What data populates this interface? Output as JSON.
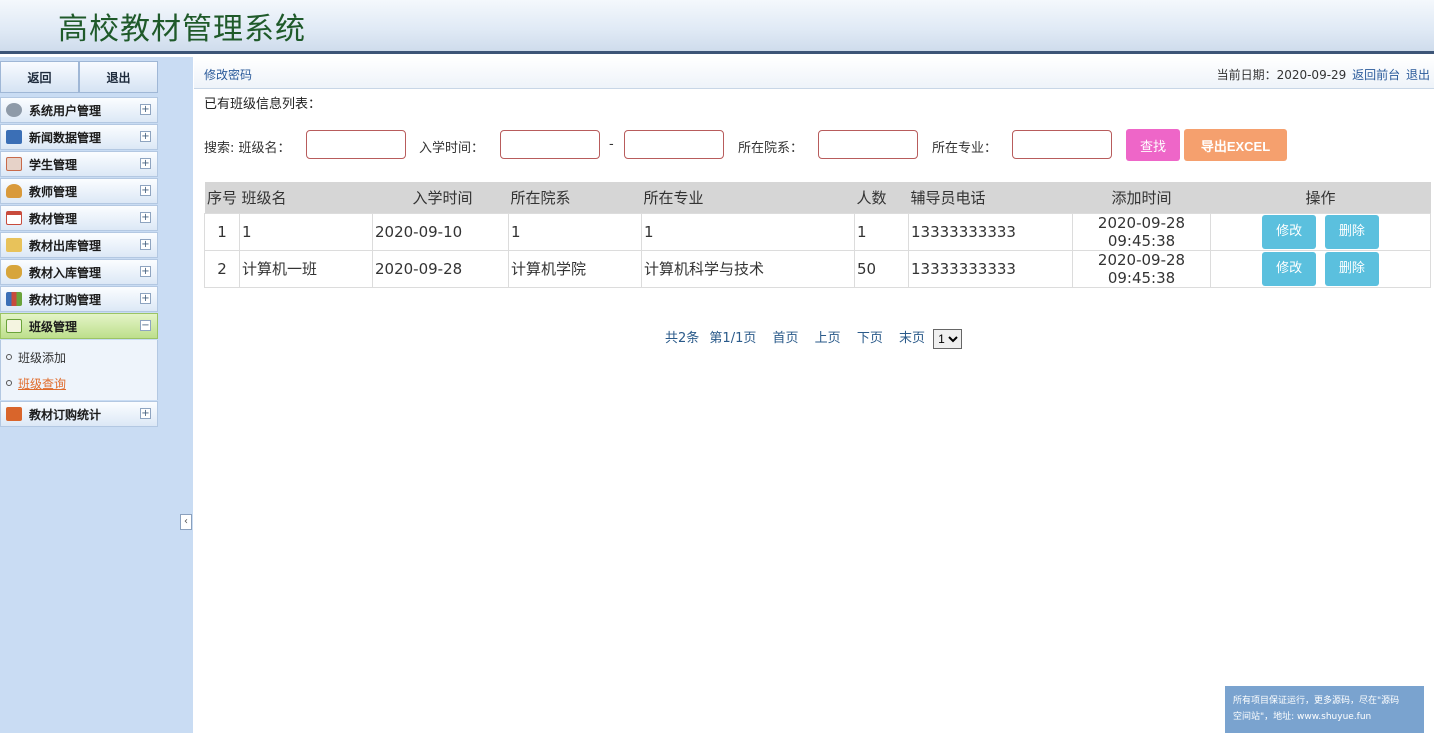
{
  "app": {
    "title": "高校教材管理系统"
  },
  "sidebar": {
    "top_buttons": [
      "返回",
      "退出"
    ],
    "menus": [
      {
        "label": "系统用户管理",
        "icon": "gear-icon",
        "color": "#7d8a99"
      },
      {
        "label": "新闻数据管理",
        "icon": "monitor-icon",
        "color": "#3b6fb6"
      },
      {
        "label": "学生管理",
        "icon": "table-icon",
        "color": "#c86a4a"
      },
      {
        "label": "教师管理",
        "icon": "user-icon",
        "color": "#d99a3b"
      },
      {
        "label": "教材管理",
        "icon": "calendar-icon",
        "color": "#c84b3c"
      },
      {
        "label": "教材出库管理",
        "icon": "folder-icon",
        "color": "#e2b43a"
      },
      {
        "label": "教材入库管理",
        "icon": "coins-icon",
        "color": "#d7a53b"
      },
      {
        "label": "教材订购管理",
        "icon": "bar-chart-icon",
        "color": "#b8423b"
      },
      {
        "label": "班级管理",
        "icon": "board-icon",
        "color": "#6aa33a"
      },
      {
        "label": "教材订购统计",
        "icon": "stats-icon",
        "color": "#d9652b"
      }
    ],
    "submenu": [
      "班级添加",
      "班级查询"
    ]
  },
  "topbar": {
    "change_password": "修改密码",
    "date_label": "当前日期：2020-09-29",
    "back_front": "返回前台",
    "logout": "退出"
  },
  "list_caption": "已有班级信息列表：",
  "search": {
    "label": "搜索: 班级名：",
    "enroll_label": "入学时间：",
    "dash": "-",
    "dept_label": "所在院系：",
    "major_label": "所在专业：",
    "search_button": "查找",
    "export_button": "导出EXCEL"
  },
  "table": {
    "headers": [
      "序号",
      "班级名",
      "入学时间",
      "所在院系",
      "所在专业",
      "人数",
      "辅导员电话",
      "添加时间",
      "操作"
    ],
    "rows": [
      {
        "no": "1",
        "name": "1",
        "enroll": "2020-09-10",
        "dept": "1",
        "major": "1",
        "count": "1",
        "phone": "13333333333",
        "added_date": "2020-09-28",
        "added_time": "09:45:38",
        "edit": "修改",
        "delete": "删除"
      },
      {
        "no": "2",
        "name": "计算机一班",
        "enroll": "2020-09-28",
        "dept": "计算机学院",
        "major": "计算机科学与技术",
        "count": "50",
        "phone": "13333333333",
        "added_date": "2020-09-28",
        "added_time": "09:45:38",
        "edit": "修改",
        "delete": "删除"
      }
    ]
  },
  "pager": {
    "total": "共2条",
    "page": "第1/1页",
    "first": "首页",
    "prev": "上页",
    "next": "下页",
    "last": "末页",
    "selected": "1"
  },
  "notice": {
    "line1": "所有项目保证运行，更多源码，尽在\"源码",
    "line2": "空间站\"，地址: www.shuyue.fun"
  }
}
